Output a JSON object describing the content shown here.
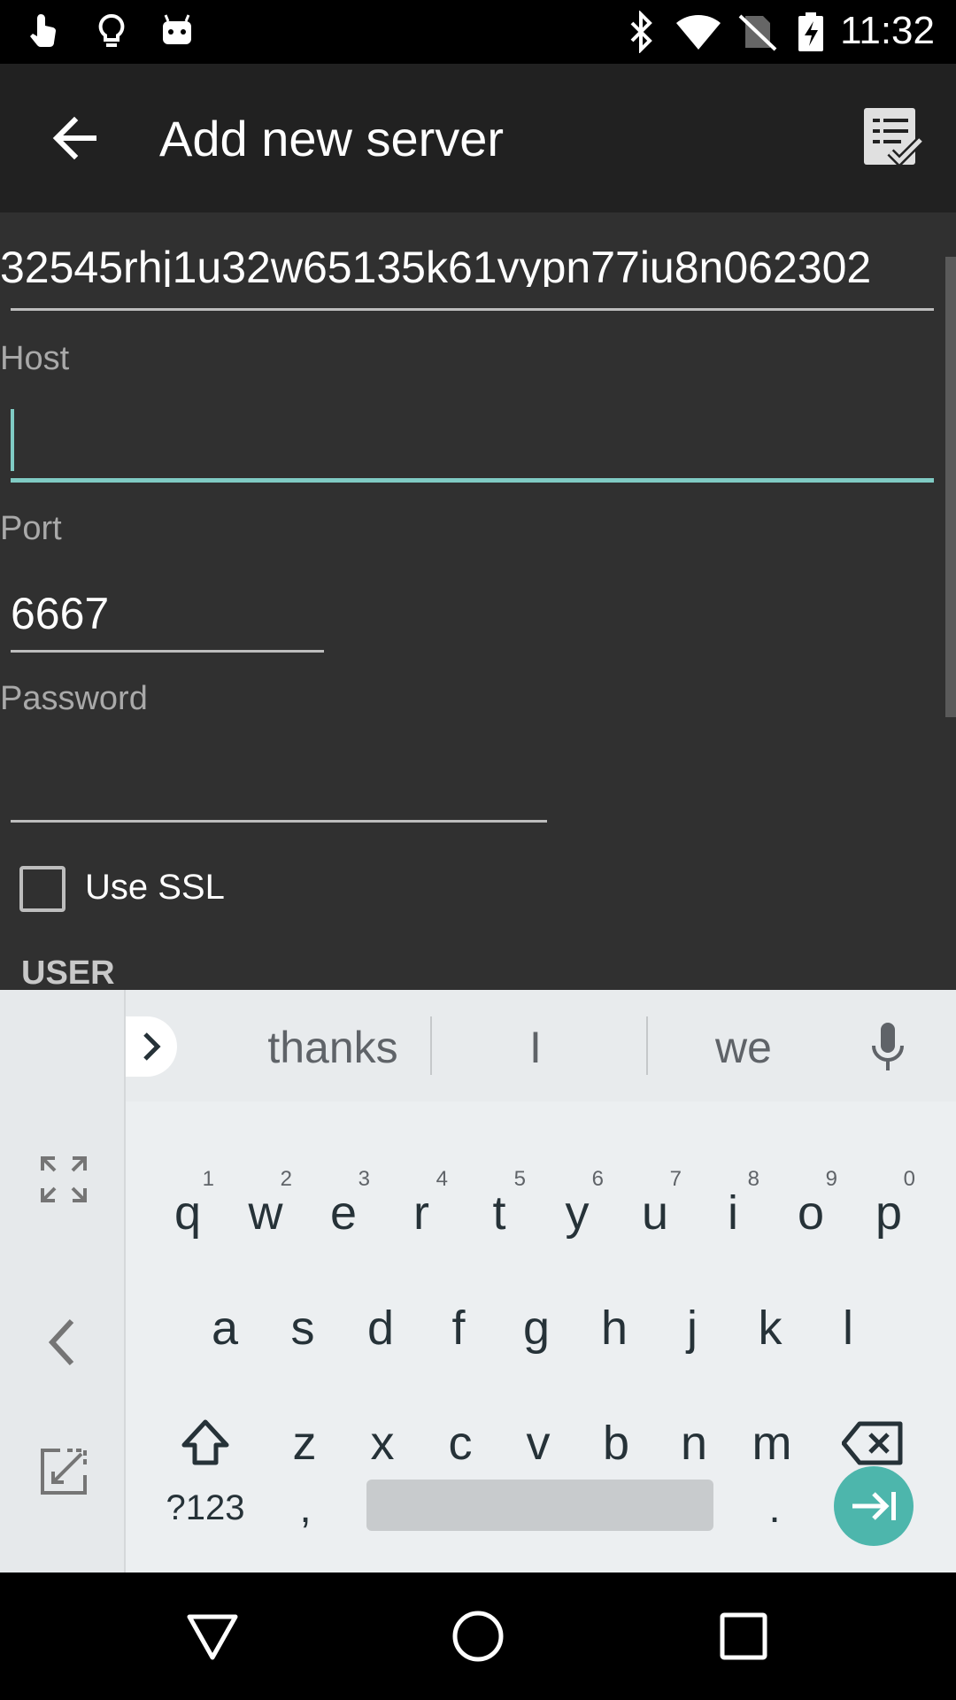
{
  "status_bar": {
    "time": "11:32",
    "icons_left": [
      "touch-hand-icon",
      "lightbulb-icon",
      "android-icon"
    ],
    "icons_right": [
      "bluetooth-icon",
      "wifi-icon",
      "no-sim-icon",
      "battery-charging-icon"
    ]
  },
  "app_bar": {
    "title": "Add new server",
    "back_icon": "arrow-back-icon",
    "save_icon": "checklist-icon"
  },
  "form": {
    "name_value": "32545rhj1u32w65135k61vypn77iu8n062302",
    "host": {
      "label": "Host",
      "value": ""
    },
    "port": {
      "label": "Port",
      "value": "6667"
    },
    "password": {
      "label": "Password",
      "value": ""
    },
    "ssl": {
      "label": "Use SSL",
      "checked": false
    },
    "user_section": "USER"
  },
  "keyboard": {
    "suggestions": [
      "thanks",
      "I",
      "we"
    ],
    "row1": [
      {
        "k": "q",
        "h": "1"
      },
      {
        "k": "w",
        "h": "2"
      },
      {
        "k": "e",
        "h": "3"
      },
      {
        "k": "r",
        "h": "4"
      },
      {
        "k": "t",
        "h": "5"
      },
      {
        "k": "y",
        "h": "6"
      },
      {
        "k": "u",
        "h": "7"
      },
      {
        "k": "i",
        "h": "8"
      },
      {
        "k": "o",
        "h": "9"
      },
      {
        "k": "p",
        "h": "0"
      }
    ],
    "row2": [
      "a",
      "s",
      "d",
      "f",
      "g",
      "h",
      "j",
      "k",
      "l"
    ],
    "row3": [
      "z",
      "x",
      "c",
      "v",
      "b",
      "n",
      "m"
    ],
    "symbols_label": "?123",
    "comma": ",",
    "period": ".",
    "accent_color": "#4db6ac"
  },
  "colors": {
    "background": "#303030",
    "app_bar": "#212121",
    "focus_accent": "#80cbc4",
    "keyboard_bg": "#eceff1"
  }
}
